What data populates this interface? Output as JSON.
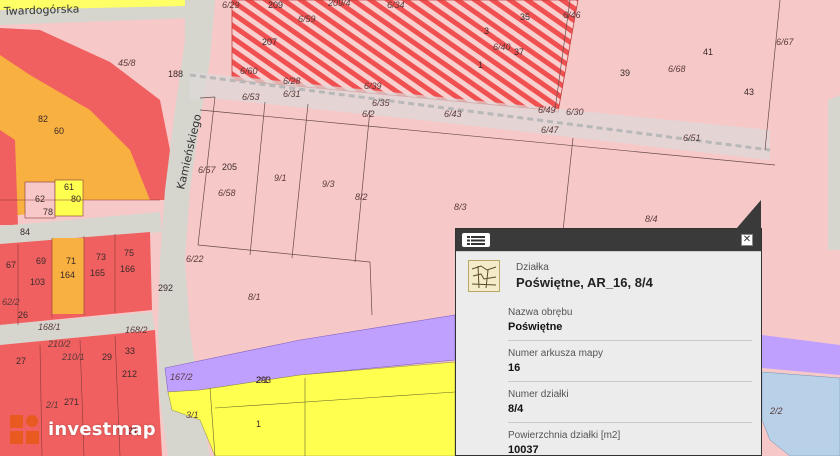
{
  "map": {
    "streets": {
      "twardogorska": "Twardogórska",
      "kamienskiego": "Kamieńskiego"
    },
    "parcel_labels": [
      "6/29",
      "209",
      "209/4",
      "6/34",
      "45/8",
      "6/59",
      "207",
      "3",
      "35",
      "6/46",
      "188",
      "6/40",
      "37",
      "41",
      "6/67",
      "1",
      "39",
      "6/68",
      "6/60",
      "6/28",
      "6/39",
      "43",
      "6/53",
      "6/31",
      "6/35",
      "6/49",
      "6/30",
      "6/2",
      "6/43",
      "6/47",
      "82",
      "60",
      "6/51",
      "6/57",
      "205",
      "9/1",
      "9/3",
      "61",
      "6/58",
      "8/2",
      "62",
      "80",
      "78",
      "8/3",
      "8/4",
      "84",
      "6/22",
      "2/1",
      "67",
      "69",
      "71",
      "73",
      "75",
      "103",
      "164",
      "165",
      "166",
      "292",
      "8/1",
      "62/2",
      "26",
      "168/1",
      "168/2",
      "33",
      "210/2",
      "27",
      "210/1",
      "29",
      "212",
      "167/2",
      "293",
      "2/1",
      "271",
      "31",
      "3/1",
      "1",
      "2/2",
      "0"
    ],
    "colors": {
      "residential_pink": "#f7c8c8",
      "red_zone": "#f06060",
      "orange_zone": "#f8b040",
      "yellow_zone": "#ffff50",
      "purple_road": "#c0a0ff",
      "street_gray": "#d6d6cf",
      "water_blue": "#b8d0e8"
    }
  },
  "popup": {
    "menu_icon": "list-menu-icon",
    "close_icon": "close-icon",
    "close_glyph": "✕",
    "feature": {
      "type": "Działka",
      "name": "Poświętne, AR_16, 8/4",
      "icon": "parcel-map-icon"
    },
    "attributes": [
      {
        "key": "Nazwa obrębu",
        "value": "Poświętne"
      },
      {
        "key": "Numer arkusza mapy",
        "value": "16"
      },
      {
        "key": "Numer działki",
        "value": "8/4"
      },
      {
        "key": "Powierzchnia działki [m2]",
        "value": "10037"
      }
    ]
  },
  "logo": {
    "text": "investmap",
    "icon": "investmap-logo-icon"
  }
}
